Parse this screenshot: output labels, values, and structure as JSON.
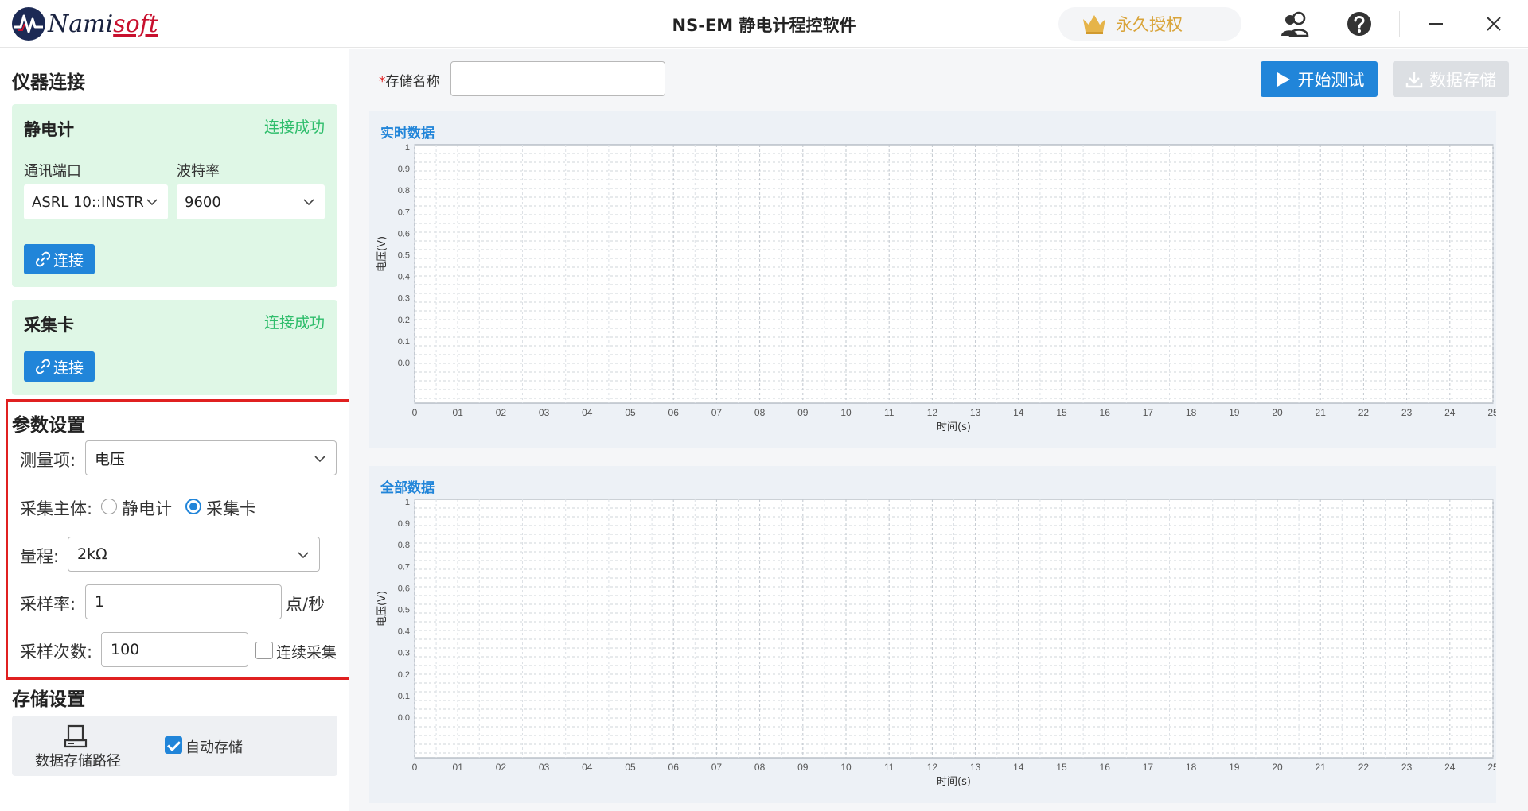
{
  "app": {
    "logo_name": "Nami",
    "logo_suffix": "soft",
    "title": "NS-EM 静电计程控软件",
    "license_label": "永久授权",
    "icons": [
      "crown-icon",
      "users-icon",
      "help-icon",
      "minimize-icon",
      "close-icon"
    ]
  },
  "sidebar": {
    "connect_title": "仪器连接",
    "electrometer": {
      "title": "静电计",
      "status": "连接成功",
      "port_label": "通讯端口",
      "port_value": "ASRL 10::INSTR",
      "baud_label": "波特率",
      "baud_value": "9600",
      "connect_label": "连接"
    },
    "daq": {
      "title": "采集卡",
      "status": "连接成功",
      "connect_label": "连接"
    },
    "params": {
      "title": "参数设置",
      "measure_label": "测量项:",
      "measure_value": "电压",
      "subject_label": "采集主体:",
      "subject_options": [
        "静电计",
        "采集卡"
      ],
      "subject_selected": "采集卡",
      "range_label": "量程:",
      "range_value": "2kΩ",
      "rate_label": "采样率:",
      "rate_value": "1",
      "rate_unit": "点/秒",
      "count_label": "采样次数:",
      "count_value": "100",
      "continuous_label": "连续采集",
      "continuous_checked": false
    },
    "storage": {
      "title": "存储设置",
      "path_label": "数据存储路径",
      "auto_label": "自动存储",
      "auto_checked": true
    }
  },
  "toolbar": {
    "name_star": "*",
    "name_label": "存储名称",
    "name_value": "",
    "start_label": "开始测试",
    "save_label": "数据存储"
  },
  "colors": {
    "accent": "#2185d9",
    "success": "#2ebd6b",
    "highlight_border": "#e02020",
    "license_gold": "#d9a43a"
  },
  "chart_data": [
    {
      "type": "line",
      "title": "实时数据",
      "xlabel": "时间(s)",
      "ylabel": "电压(V)",
      "x_ticks": [
        "0",
        "01",
        "02",
        "03",
        "04",
        "05",
        "06",
        "07",
        "08",
        "09",
        "10",
        "11",
        "12",
        "13",
        "14",
        "15",
        "16",
        "17",
        "18",
        "19",
        "20",
        "21",
        "22",
        "23",
        "24",
        "25"
      ],
      "y_ticks": [
        "1",
        "0.9",
        "0.8",
        "0.7",
        "0.6",
        "0.5",
        "0.4",
        "0.3",
        "0.2",
        "0.1",
        "0.0"
      ],
      "xlim": [
        0,
        25
      ],
      "ylim": [
        0,
        1
      ],
      "grid": true,
      "series": []
    },
    {
      "type": "line",
      "title": "全部数据",
      "xlabel": "时间(s)",
      "ylabel": "电压(V)",
      "x_ticks": [
        "0",
        "01",
        "02",
        "03",
        "04",
        "05",
        "06",
        "07",
        "08",
        "09",
        "10",
        "11",
        "12",
        "13",
        "14",
        "15",
        "16",
        "17",
        "18",
        "19",
        "20",
        "21",
        "22",
        "23",
        "24",
        "25"
      ],
      "y_ticks": [
        "1",
        "0.9",
        "0.8",
        "0.7",
        "0.6",
        "0.5",
        "0.4",
        "0.3",
        "0.2",
        "0.1",
        "0.0"
      ],
      "xlim": [
        0,
        25
      ],
      "ylim": [
        0,
        1
      ],
      "grid": true,
      "series": []
    }
  ]
}
